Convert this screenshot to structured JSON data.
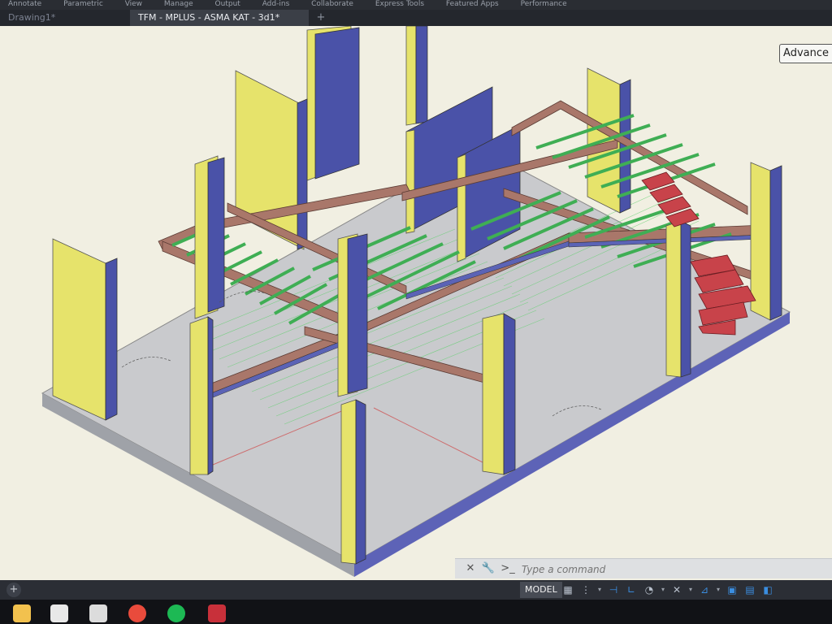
{
  "menu": {
    "items": [
      "Annotate",
      "Parametric",
      "View",
      "Manage",
      "Output",
      "Add-ins",
      "Collaborate",
      "Express Tools",
      "Featured Apps",
      "Performance"
    ]
  },
  "tabs": {
    "inactive_label": "Drawing1*",
    "active_label": "TFM - MPLUS - ASMA KAT - 3d1*",
    "add_symbol": "+"
  },
  "viewport": {
    "advance_label": "Advance",
    "background_color": "#f1efe2"
  },
  "command_line": {
    "placeholder": "Type a command",
    "close_symbol": "✕",
    "wrench_symbol": "🔧",
    "prompt_symbol": ">_"
  },
  "status_bar": {
    "add_symbol": "+",
    "model_label": "MODEL",
    "tool_icons": [
      "grid-icon",
      "snap-icon",
      "dropdown-icon",
      "infer-constraints-icon",
      "ortho-icon",
      "polar-icon",
      "dropdown-icon",
      "osnap-icon",
      "dropdown-icon",
      "annotation-scale-icon",
      "dropdown-icon",
      "workspace-icon",
      "lock-ui-icon",
      "isolate-icon"
    ]
  },
  "taskbar": {
    "apps": [
      {
        "name": "file-explorer-icon",
        "color": "#f2c14e"
      },
      {
        "name": "store-icon",
        "color": "#e8e8e8"
      },
      {
        "name": "mail-icon",
        "color": "#dcdcdc"
      },
      {
        "name": "chrome-icon",
        "color": "#e94b3c"
      },
      {
        "name": "spotify-icon",
        "color": "#1db954"
      },
      {
        "name": "autocad-icon",
        "color": "#c8303a"
      }
    ]
  },
  "colors": {
    "column_face": "#e6e36b",
    "column_side": "#4a52a8",
    "beam": "#a9776a",
    "joist": "#3fae54",
    "stair": "#c8434a",
    "slab": "#c9cacd"
  }
}
